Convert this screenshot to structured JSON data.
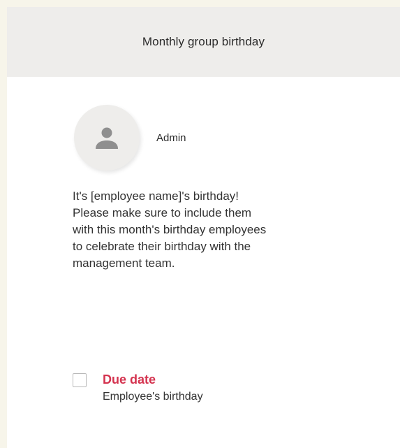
{
  "header": {
    "title": "Monthly group birthday"
  },
  "author": {
    "icon": "person-icon",
    "name": "Admin"
  },
  "message": {
    "body": "It's [employee name]'s birthday!\nPlease make sure to include them\nwith this month's birthday employees\nto celebrate their birthday with the\nmanagement team."
  },
  "due": {
    "checked": false,
    "label": "Due date",
    "value": "Employee's birthday"
  },
  "colors": {
    "page_background": "#f7f5ea",
    "header_background": "#eeedeb",
    "accent_due": "#d4334f",
    "avatar_icon": "#8f8f8f"
  }
}
